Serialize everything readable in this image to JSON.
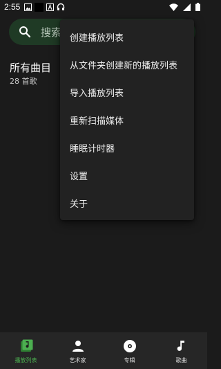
{
  "status_bar": {
    "time": "2:55",
    "icons": [
      "image-icon",
      "black-square-icon",
      "text-a-icon",
      "headphones-icon",
      "wifi-icon",
      "signal-icon",
      "battery-icon"
    ]
  },
  "search": {
    "placeholder": "搜索"
  },
  "playlists": [
    {
      "title": "所有曲目",
      "subtitle": "28 首歌"
    }
  ],
  "menu": {
    "items": [
      "创建播放列表",
      "从文件夹创建新的播放列表",
      "导入播放列表",
      "重新扫描媒体",
      "睡眠计时器",
      "设置",
      "关于"
    ]
  },
  "bottom_nav": {
    "items": [
      {
        "label": "播放列表",
        "icon": "playlist-icon",
        "active": true
      },
      {
        "label": "艺术家",
        "icon": "person-icon",
        "active": false
      },
      {
        "label": "专辑",
        "icon": "disc-icon",
        "active": false
      },
      {
        "label": "歌曲",
        "icon": "music-note-icon",
        "active": false
      }
    ]
  },
  "colors": {
    "background": "#1b1b1b",
    "accent": "#4caf50",
    "search_bg": "#1f3a25",
    "menu_bg": "#222222",
    "nav_bg": "#262626"
  }
}
